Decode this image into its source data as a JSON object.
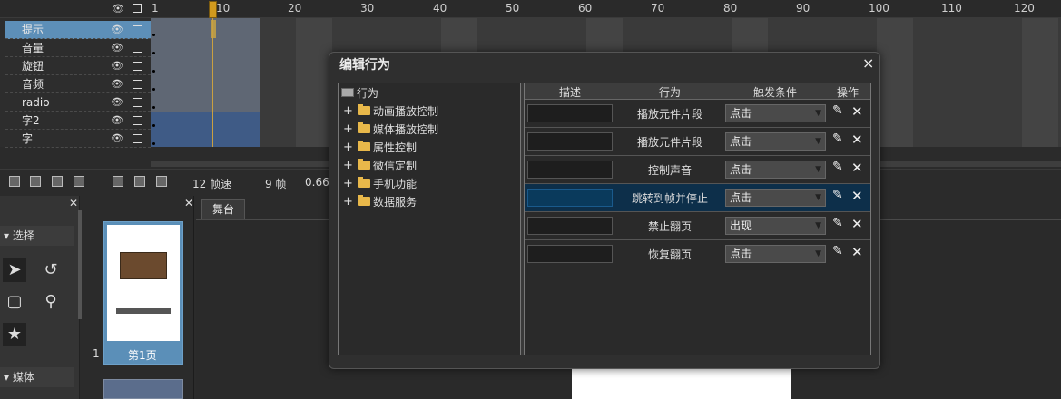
{
  "timeline": {
    "ruler_ticks": [
      "1",
      "10",
      "20",
      "30",
      "40",
      "50",
      "60",
      "70",
      "80",
      "90",
      "100",
      "110",
      "120"
    ],
    "layers": [
      {
        "name": "提示",
        "selected": true
      },
      {
        "name": "音量",
        "selected": false
      },
      {
        "name": "旋钮",
        "selected": false
      },
      {
        "name": "音频",
        "selected": false
      },
      {
        "name": "radio",
        "selected": false
      },
      {
        "name": "字2",
        "selected": false
      },
      {
        "name": "字",
        "selected": false
      }
    ],
    "toolbar": {
      "fps": "12 帧速",
      "frames": "9 帧",
      "time": "0.66"
    }
  },
  "left_panel": {
    "select_section": "选择",
    "media_section": "媒体"
  },
  "pages": {
    "page1_number": "1",
    "page1_label": "第1页"
  },
  "stage": {
    "tab_label": "舞台"
  },
  "dialog": {
    "title": "编辑行为",
    "close": "×",
    "tree": {
      "root": "行为",
      "items": [
        "动画播放控制",
        "媒体播放控制",
        "属性控制",
        "微信定制",
        "手机功能",
        "数据服务"
      ]
    },
    "table": {
      "headers": {
        "desc": "描述",
        "behavior": "行为",
        "trigger": "触发条件",
        "ops": "操作"
      },
      "rows": [
        {
          "desc": "",
          "behavior": "播放元件片段",
          "trigger": "点击"
        },
        {
          "desc": "",
          "behavior": "播放元件片段",
          "trigger": "点击"
        },
        {
          "desc": "",
          "behavior": "控制声音",
          "trigger": "点击"
        },
        {
          "desc": "",
          "behavior": "跳转到帧并停止",
          "trigger": "点击",
          "selected": true
        },
        {
          "desc": "",
          "behavior": "禁止翻页",
          "trigger": "出现"
        },
        {
          "desc": "",
          "behavior": "恢复翻页",
          "trigger": "点击"
        }
      ]
    }
  }
}
